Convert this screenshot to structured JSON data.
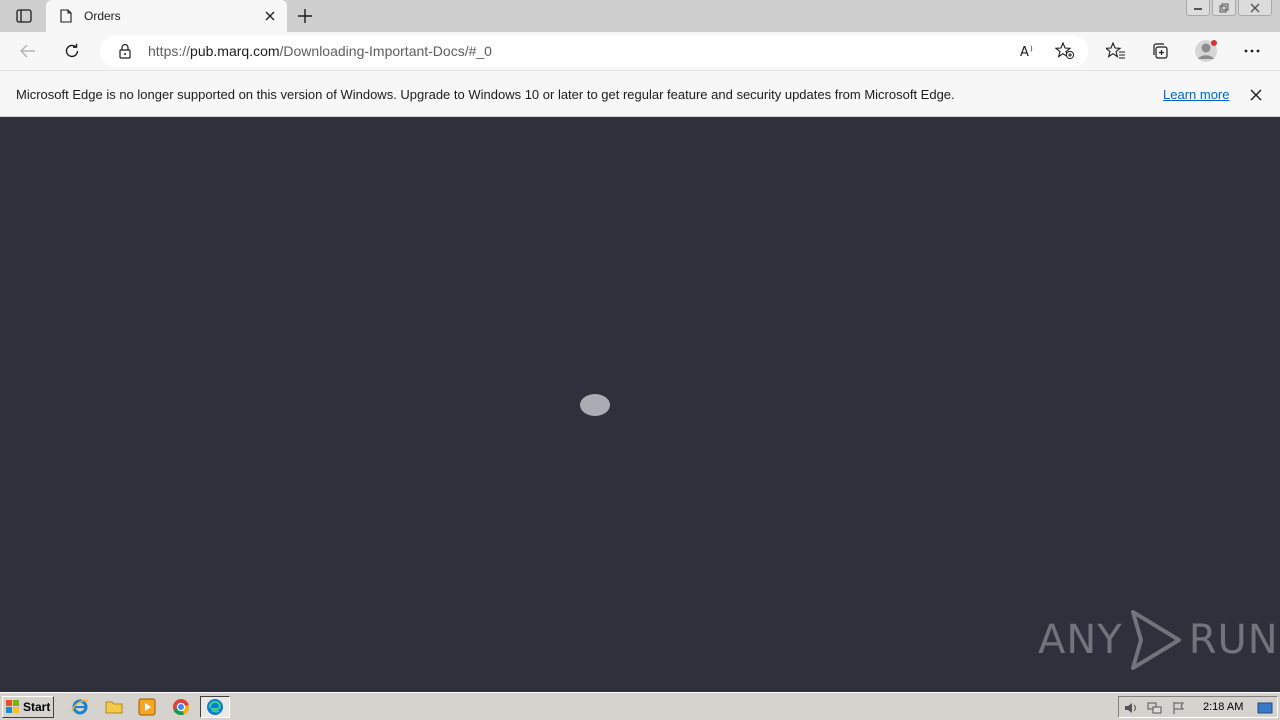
{
  "browser": {
    "tab": {
      "title": "Orders"
    },
    "address": {
      "url_prefix": "https://",
      "url_host": "pub.marq.com",
      "url_path": "/Downloading-Important-Docs/#_0"
    },
    "icons": [
      "tab-actions-icon",
      "page-icon",
      "close-icon",
      "plus-icon",
      "back-icon",
      "refresh-icon",
      "lock-icon",
      "read-aloud-icon",
      "add-favorite-icon",
      "favorites-icon",
      "collections-icon",
      "profile-avatar",
      "more-icon"
    ]
  },
  "infobar": {
    "message": "Microsoft Edge is no longer supported on this version of Windows. Upgrade to Windows 10 or later to get regular feature and security updates from Microsoft Edge.",
    "link": "Learn more"
  },
  "watermark": {
    "left": "ANY",
    "right": "RUN"
  },
  "taskbar": {
    "start_label": "Start",
    "apps": [
      "internet-explorer-icon",
      "folder-icon",
      "media-player-icon",
      "chrome-icon",
      "edge-icon"
    ],
    "clock": "2:18 AM"
  },
  "colors": {
    "content_bg": "#2e313b",
    "link": "#0064c0",
    "tab_bar": "#cfcfcf"
  }
}
